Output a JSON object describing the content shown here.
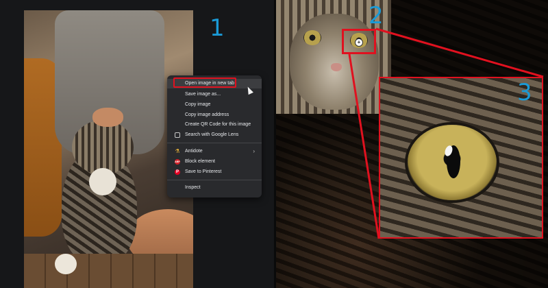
{
  "steps": {
    "one": "1",
    "two": "2",
    "three": "3"
  },
  "context_menu": {
    "items": [
      {
        "label": "Open image in new tab",
        "icon": ""
      },
      {
        "label": "Save image as...",
        "icon": ""
      },
      {
        "label": "Copy image",
        "icon": ""
      },
      {
        "label": "Copy image address",
        "icon": ""
      },
      {
        "label": "Create QR Code for this image",
        "icon": ""
      },
      {
        "label": "Search with Google Lens",
        "icon": "google-lens-icon"
      },
      {
        "label": "Antidote",
        "icon": "antidote-icon",
        "has_submenu": true
      },
      {
        "label": "Block element",
        "icon": "adblock-icon"
      },
      {
        "label": "Save to Pinterest",
        "icon": "pinterest-icon"
      },
      {
        "label": "Inspect",
        "icon": ""
      }
    ],
    "submenu_arrow": "›",
    "adblock_icon_text": "ABP",
    "pinterest_icon_text": "P"
  },
  "zoom_icon_glyph": "+",
  "colors": {
    "highlight_red": "#e0111f",
    "step_blue": "#1a9ad6",
    "menu_bg": "#292a2d",
    "menu_text": "#e8eaed"
  }
}
